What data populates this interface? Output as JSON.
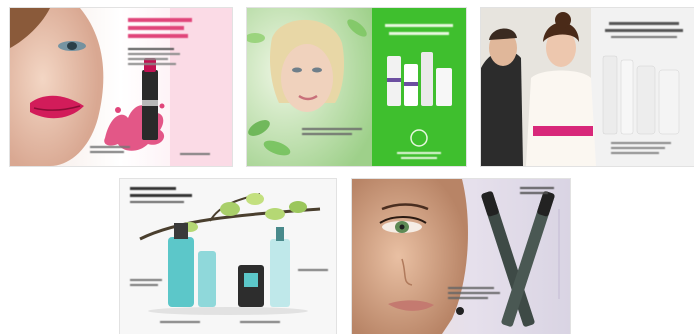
{
  "gallery": {
    "items": [
      {
        "name": "pink-lipstick-ad"
      },
      {
        "name": "green-bridal-skincare-ad"
      },
      {
        "name": "couple-wedding-skincare-ad"
      },
      {
        "name": "blue-bottles-branch-ad"
      },
      {
        "name": "green-eyes-mascara-ad"
      }
    ]
  },
  "colors": {
    "pink_accent": "#e0457a",
    "green_panel": "#3fbf2e",
    "magenta_sash": "#d8287a",
    "aqua_bottle": "#5cc7c9",
    "lavender_bg": "#d9d4e3"
  }
}
